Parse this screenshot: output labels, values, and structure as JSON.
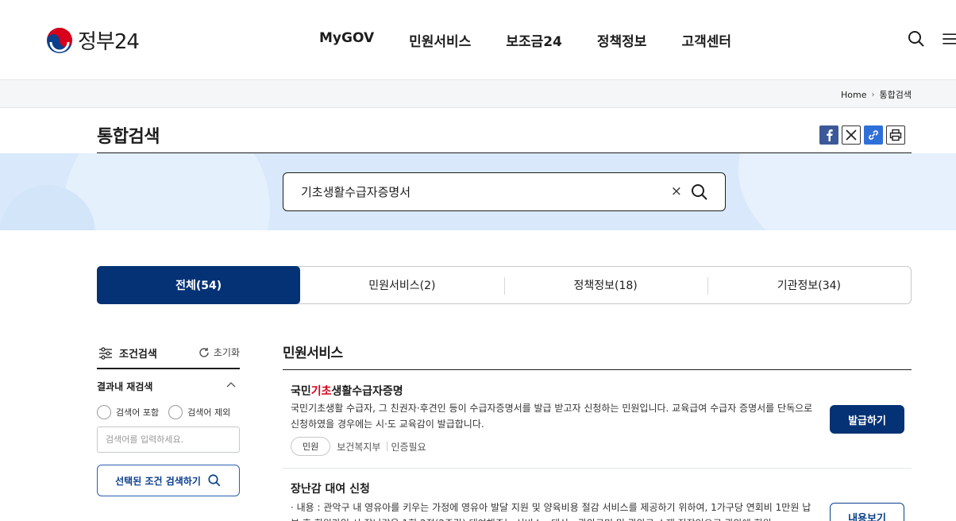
{
  "brand": {
    "logo_text": "정부24"
  },
  "nav": [
    "MyGOV",
    "민원서비스",
    "보조금24",
    "정책정보",
    "고객센터"
  ],
  "breadcrumb": {
    "home": "Home",
    "current": "통합검색"
  },
  "page": {
    "title": "통합검색"
  },
  "search": {
    "query": "기초생활수급자증명서",
    "clear_label": "×"
  },
  "tabs": [
    {
      "label": "전체(54)",
      "active": true
    },
    {
      "label": "민원서비스(2)",
      "active": false
    },
    {
      "label": "정책정보(18)",
      "active": false
    },
    {
      "label": "기관정보(34)",
      "active": false
    }
  ],
  "filter": {
    "title": "조건검색",
    "reset": "초기화",
    "section_title": "결과내 재검색",
    "include_label": "검색어 포함",
    "exclude_label": "검색어 제외",
    "input_placeholder": "검색어를 입력하세요.",
    "apply_label": "선택된 조건 검색하기"
  },
  "results": {
    "section_title": "민원서비스",
    "items": [
      {
        "title_pre": "국민",
        "title_hl": "기초",
        "title_post": "생활수급자증명",
        "desc": "국민기초생활 수급자, 그 친권자·후견인 등이 수급자증명서를 발급 받고자 신청하는 민원입니다. 교육급여 수급자 증명서를 단독으로 신청하였을 경우에는 시·도 교육감이 발급합니다.",
        "badge": "민원",
        "agency": "보건복지부",
        "auth": "인증필요",
        "button": "발급하기"
      },
      {
        "title": "장난감 대여 신청",
        "desc": "· 내용 : 관악구 내 영유아를 키우는 가정에 영유아 발달 지원 및 양육비용 절감 서비스를 제공하기 위하여, 1가구당 연회비 1만원 납부 후 회원가입 시 장난감을 1회 2점(2주간) 대여해주는 서비스 · 대상 : 관악구민 및 관악구 소재 직장인으로 관악에 회원",
        "button": "내용보기"
      }
    ]
  },
  "colors": {
    "primary": "#053274",
    "band": "#d9e9fb",
    "highlight": "#d8001a"
  }
}
